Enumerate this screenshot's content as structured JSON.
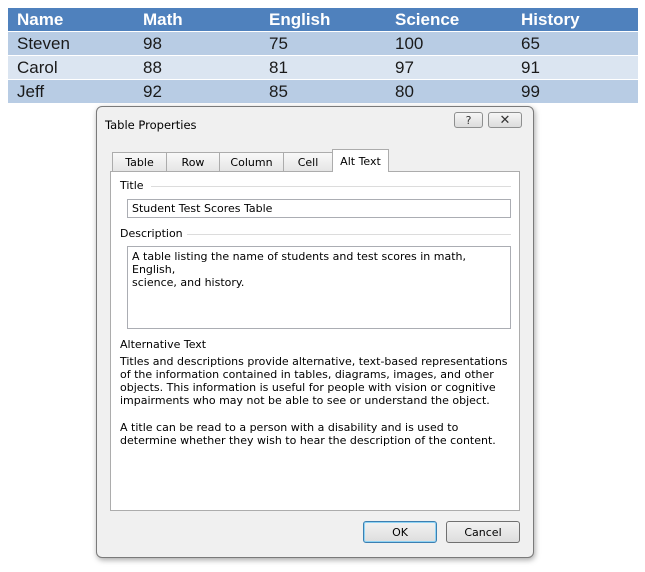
{
  "table": {
    "headers": [
      "Name",
      "Math",
      "English",
      "Science",
      "History"
    ],
    "rows": [
      [
        "Steven",
        "98",
        "75",
        "100",
        "65"
      ],
      [
        "Carol",
        "88",
        "81",
        "97",
        "91"
      ],
      [
        "Jeff",
        "92",
        "85",
        "80",
        "99"
      ]
    ],
    "colors": {
      "header_bg": "#4f81bd",
      "band_dark": "#b8cce4",
      "band_light": "#dbe5f1"
    }
  },
  "dialog": {
    "title": "Table Properties",
    "help_icon": "question-mark-icon",
    "close_icon": "close-x-icon",
    "help_glyph": "?",
    "close_glyph": "✕",
    "tabs": [
      {
        "label": "Table"
      },
      {
        "label": "Row"
      },
      {
        "label": "Column"
      },
      {
        "label": "Cell"
      },
      {
        "label": "Alt Text",
        "active": true
      }
    ],
    "title_label": "Title",
    "title_value": "Student Test Scores Table",
    "description_label": "Description",
    "description_value": "A table listing the name of students and test scores in math, English,\nscience, and history.",
    "alt_text_heading": "Alternative Text",
    "alt_text_para1": "Titles and descriptions provide alternative, text-based representations of the information contained in tables, diagrams, images, and other objects. This information is useful for people with vision or cognitive impairments who may not be able to see or understand the object.",
    "alt_text_para2": "A title can be read to a person with a disability and is used to determine whether they wish to hear the description of the content.",
    "ok_label": "OK",
    "cancel_label": "Cancel"
  }
}
